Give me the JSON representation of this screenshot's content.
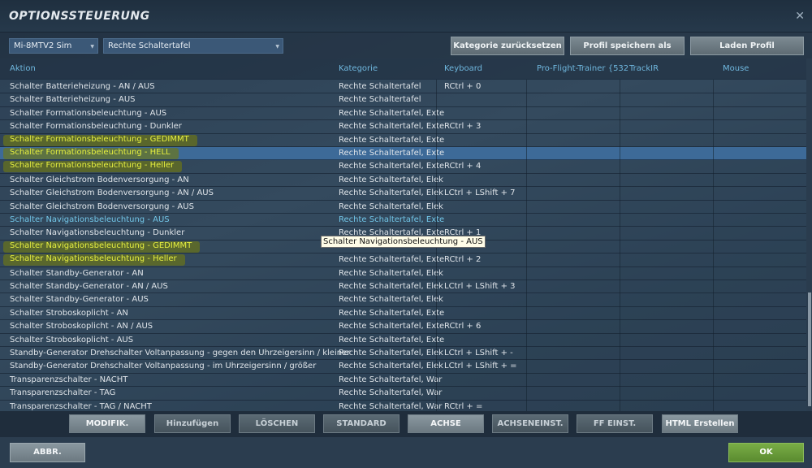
{
  "window": {
    "title": "OPTIONSSTEUERUNG",
    "close": "✕"
  },
  "toolbar": {
    "aircraft": "Mi-8MTV2 Sim",
    "category": "Rechte Schaltertafel",
    "reset": "Kategorie zurücksetzen",
    "save_profile": "Profil speichern als",
    "load_profile": "Laden Profil"
  },
  "columns": [
    "Aktion",
    "Kategorie",
    "Keyboard",
    "Pro-Flight-Trainer {532",
    "TrackIR",
    "Mouse"
  ],
  "rows": [
    {
      "action": "Schalter Batterieheizung - AN / AUS",
      "category": "Rechte Schaltertafel",
      "keyboard": "RCtrl + 0"
    },
    {
      "action": "Schalter Batterieheizung - AUS",
      "category": "Rechte Schaltertafel",
      "keyboard": ""
    },
    {
      "action": "Schalter Formationsbeleuchtung - AUS",
      "category": "Rechte Schaltertafel, Exte",
      "keyboard": ""
    },
    {
      "action": "Schalter Formationsbeleuchtung - Dunkler",
      "category": "Rechte Schaltertafel, Exte",
      "keyboard": "RCtrl + 3"
    },
    {
      "action": "Schalter Formationsbeleuchtung - GEDIMMT",
      "category": "Rechte Schaltertafel, Exte",
      "keyboard": "",
      "marked": true
    },
    {
      "action": "Schalter Formationsbeleuchtung - HELL",
      "category": "Rechte Schaltertafel, Exte",
      "keyboard": "",
      "marked": true,
      "selected": true
    },
    {
      "action": "Schalter Formationsbeleuchtung - Heller",
      "category": "Rechte Schaltertafel, Exte",
      "keyboard": "RCtrl + 4",
      "marked": true
    },
    {
      "action": "Schalter Gleichstrom Bodenversorgung - AN",
      "category": "Rechte Schaltertafel, Elek",
      "keyboard": ""
    },
    {
      "action": "Schalter Gleichstrom Bodenversorgung - AN / AUS",
      "category": "Rechte Schaltertafel, Elek",
      "keyboard": "LCtrl + LShift + 7"
    },
    {
      "action": "Schalter Gleichstrom Bodenversorgung - AUS",
      "category": "Rechte Schaltertafel, Elek",
      "keyboard": ""
    },
    {
      "action": "Schalter Navigationsbeleuchtung - AUS",
      "category": "Rechte Schaltertafel, Exte",
      "keyboard": "",
      "hover": true
    },
    {
      "action": "Schalter Navigationsbeleuchtung - Dunkler",
      "category": "Rechte Schaltertafel, Exte",
      "keyboard": "RCtrl + 1"
    },
    {
      "action": "Schalter Navigationsbeleuchtung - GEDIMMT",
      "category": "",
      "keyboard": "",
      "marked": true
    },
    {
      "action": "Schalter Navigationsbeleuchtung - Heller",
      "category": "Rechte Schaltertafel, Exte",
      "keyboard": "RCtrl + 2",
      "marked": true
    },
    {
      "action": "Schalter Standby-Generator - AN",
      "category": "Rechte Schaltertafel, Elek",
      "keyboard": ""
    },
    {
      "action": "Schalter Standby-Generator - AN / AUS",
      "category": "Rechte Schaltertafel, Elek",
      "keyboard": "LCtrl + LShift + 3"
    },
    {
      "action": "Schalter Standby-Generator - AUS",
      "category": "Rechte Schaltertafel, Elek",
      "keyboard": ""
    },
    {
      "action": "Schalter Stroboskoplicht - AN",
      "category": "Rechte Schaltertafel, Exte",
      "keyboard": ""
    },
    {
      "action": "Schalter Stroboskoplicht - AN / AUS",
      "category": "Rechte Schaltertafel, Exte",
      "keyboard": "RCtrl + 6"
    },
    {
      "action": "Schalter Stroboskoplicht - AUS",
      "category": "Rechte Schaltertafel, Exte",
      "keyboard": ""
    },
    {
      "action": "Standby-Generator Drehschalter Voltanpassung - gegen den Uhrzeigersinn / kleiner",
      "category": "Rechte Schaltertafel, Elek",
      "keyboard": "LCtrl + LShift + -"
    },
    {
      "action": "Standby-Generator Drehschalter Voltanpassung - im Uhrzeigersinn / größer",
      "category": "Rechte Schaltertafel, Elek",
      "keyboard": "LCtrl + LShift + ="
    },
    {
      "action": "Transparenzschalter - NACHT",
      "category": "Rechte Schaltertafel, War",
      "keyboard": ""
    },
    {
      "action": "Transparenzschalter - TAG",
      "category": "Rechte Schaltertafel, War",
      "keyboard": ""
    },
    {
      "action": "Transparenzschalter - TAG / NACHT",
      "category": "Rechte Schaltertafel, War",
      "keyboard": "RCtrl + ="
    }
  ],
  "tooltip": "Schalter Navigationsbeleuchtung - AUS",
  "bottom_buttons": [
    "MODIFIK.",
    "Hinzufügen",
    "LÖSCHEN",
    "STANDARD",
    "ACHSE",
    "ACHSENEINST.",
    "FF EINST.",
    "HTML Erstellen"
  ],
  "footer": {
    "cancel": "ABBR.",
    "ok": "OK"
  },
  "colors": {
    "selected_row": "#3d6a98",
    "header_text": "#6fb7de",
    "ok_button": "#6a9a3a",
    "marker_text": "#e6ef40"
  }
}
